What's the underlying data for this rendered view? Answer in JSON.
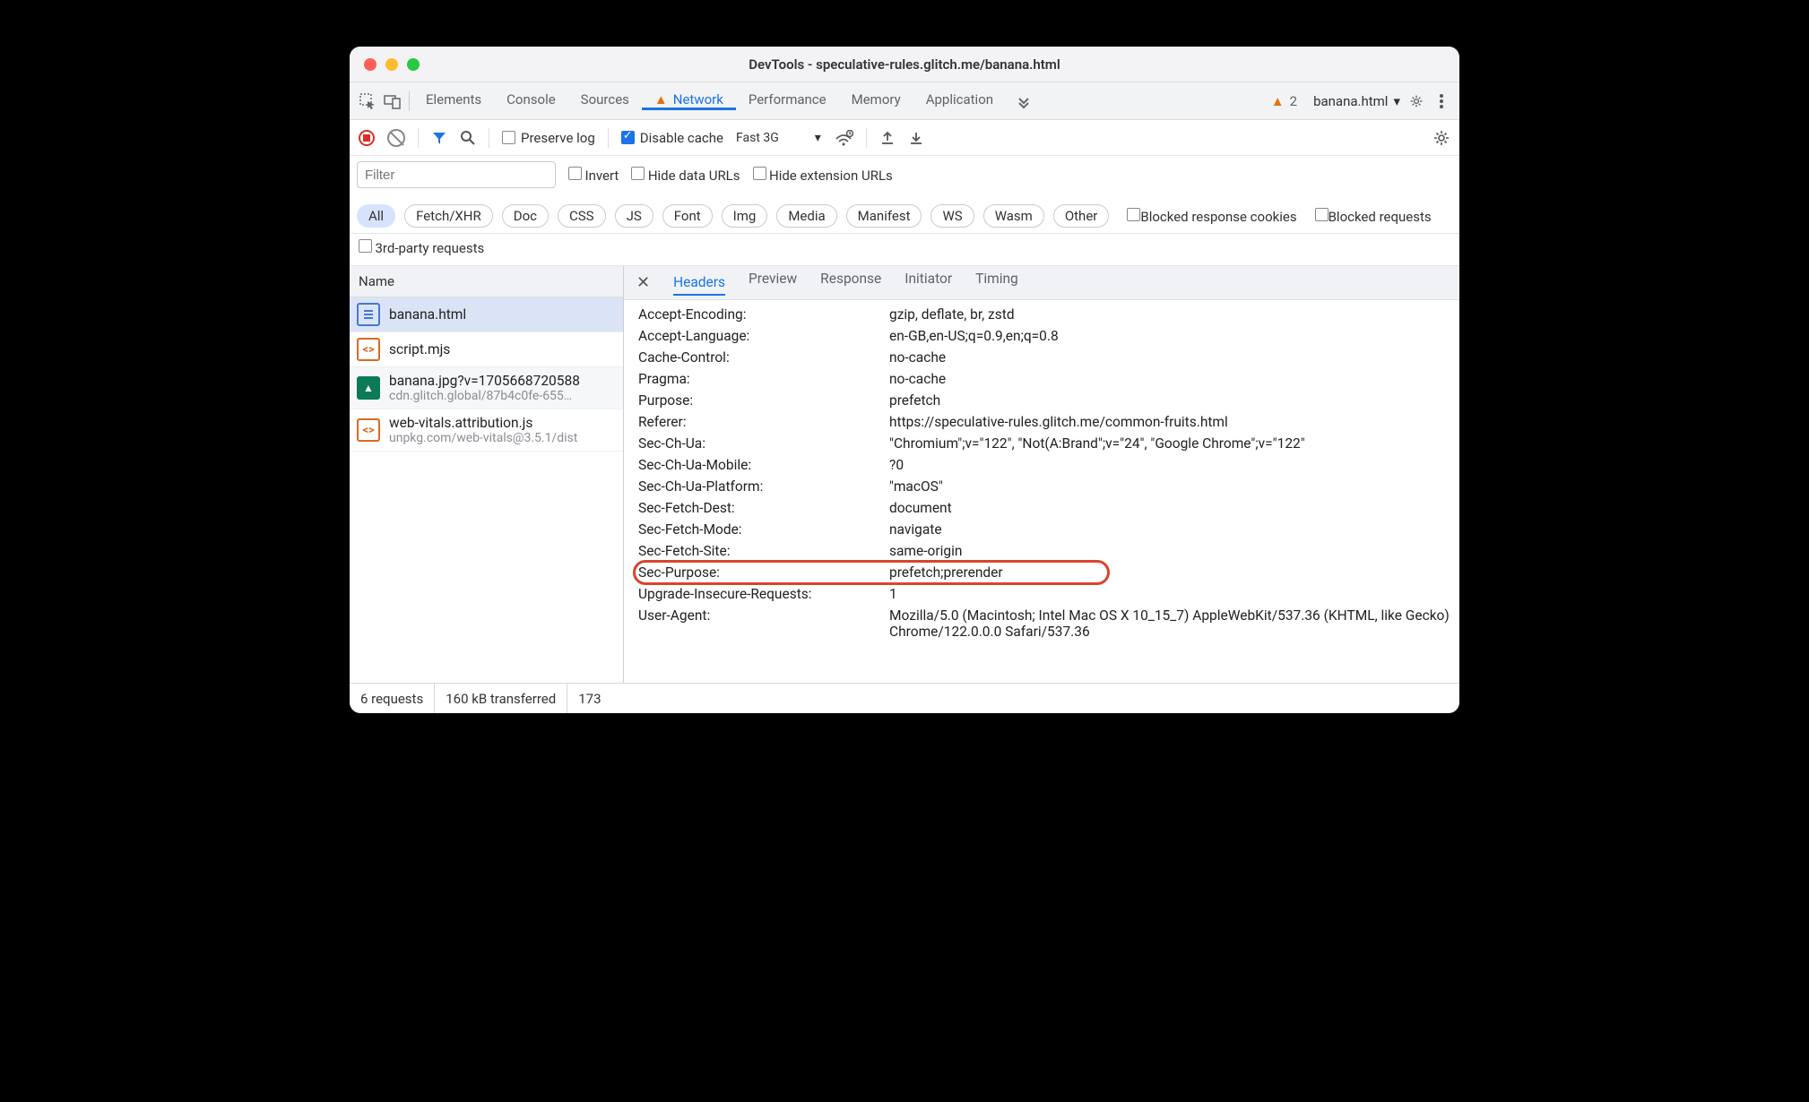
{
  "window": {
    "title": "DevTools - speculative-rules.glitch.me/banana.html"
  },
  "mainTabs": {
    "items": [
      "Elements",
      "Console",
      "Sources",
      "Network",
      "Performance",
      "Memory",
      "Application"
    ],
    "active": "Network",
    "warnCount": "2",
    "context": "banana.html"
  },
  "toolbar": {
    "preserveLog": "Preserve log",
    "disableCache": "Disable cache",
    "throttle": "Fast 3G"
  },
  "filters": {
    "placeholder": "Filter",
    "invert": "Invert",
    "hideData": "Hide data URLs",
    "hideExt": "Hide extension URLs",
    "types": [
      "All",
      "Fetch/XHR",
      "Doc",
      "CSS",
      "JS",
      "Font",
      "Img",
      "Media",
      "Manifest",
      "WS",
      "Wasm",
      "Other"
    ],
    "blockedCookies": "Blocked response cookies",
    "blockedReq": "Blocked requests",
    "thirdParty": "3rd-party requests"
  },
  "requests": {
    "header": "Name",
    "items": [
      {
        "name": "banana.html",
        "domain": "",
        "icon": "doc",
        "selected": true
      },
      {
        "name": "script.mjs",
        "domain": "",
        "icon": "code"
      },
      {
        "name": "banana.jpg?v=1705668720588",
        "domain": "cdn.glitch.global/87b4c0fe-655…",
        "icon": "img",
        "alt": true
      },
      {
        "name": "web-vitals.attribution.js",
        "domain": "unpkg.com/web-vitals@3.5.1/dist",
        "icon": "code"
      }
    ]
  },
  "detail": {
    "tabs": [
      "Headers",
      "Preview",
      "Response",
      "Initiator",
      "Timing"
    ],
    "active": "Headers",
    "headers": [
      {
        "k": "Accept-Encoding:",
        "v": "gzip, deflate, br, zstd"
      },
      {
        "k": "Accept-Language:",
        "v": "en-GB,en-US;q=0.9,en;q=0.8"
      },
      {
        "k": "Cache-Control:",
        "v": "no-cache"
      },
      {
        "k": "Pragma:",
        "v": "no-cache"
      },
      {
        "k": "Purpose:",
        "v": "prefetch"
      },
      {
        "k": "Referer:",
        "v": "https://speculative-rules.glitch.me/common-fruits.html"
      },
      {
        "k": "Sec-Ch-Ua:",
        "v": "\"Chromium\";v=\"122\", \"Not(A:Brand\";v=\"24\", \"Google Chrome\";v=\"122\""
      },
      {
        "k": "Sec-Ch-Ua-Mobile:",
        "v": "?0"
      },
      {
        "k": "Sec-Ch-Ua-Platform:",
        "v": "\"macOS\""
      },
      {
        "k": "Sec-Fetch-Dest:",
        "v": "document"
      },
      {
        "k": "Sec-Fetch-Mode:",
        "v": "navigate"
      },
      {
        "k": "Sec-Fetch-Site:",
        "v": "same-origin"
      },
      {
        "k": "Sec-Purpose:",
        "v": "prefetch;prerender",
        "hl": true
      },
      {
        "k": "Upgrade-Insecure-Requests:",
        "v": "1"
      },
      {
        "k": "User-Agent:",
        "v": "Mozilla/5.0 (Macintosh; Intel Mac OS X 10_15_7) AppleWebKit/537.36 (KHTML, like Gecko) Chrome/122.0.0.0 Safari/537.36"
      }
    ]
  },
  "status": {
    "requests": "6 requests",
    "transferred": "160 kB transferred",
    "resources": "173"
  }
}
